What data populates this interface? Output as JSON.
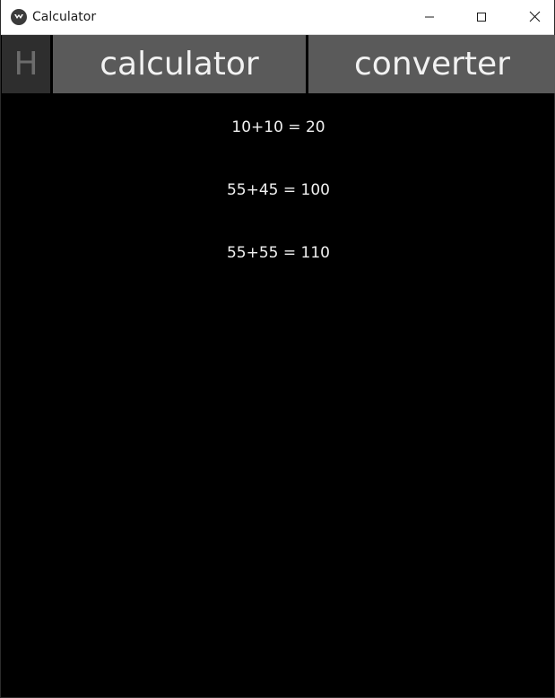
{
  "window": {
    "title": "Calculator",
    "app_icon": "kivy-logo-icon",
    "controls": {
      "minimize_icon": "minimize-icon",
      "maximize_icon": "maximize-icon",
      "close_icon": "close-icon"
    }
  },
  "tabs": [
    {
      "label": "H"
    },
    {
      "label": "calculator"
    },
    {
      "label": "converter"
    }
  ],
  "history": [
    "10+10 = 20",
    "55+45 = 100",
    "55+55 = 110"
  ],
  "colors": {
    "background": "#000000",
    "tab_bg": "#5a5a5a",
    "tab_h_bg": "#2e2e2e",
    "text": "#f0f0f0"
  }
}
